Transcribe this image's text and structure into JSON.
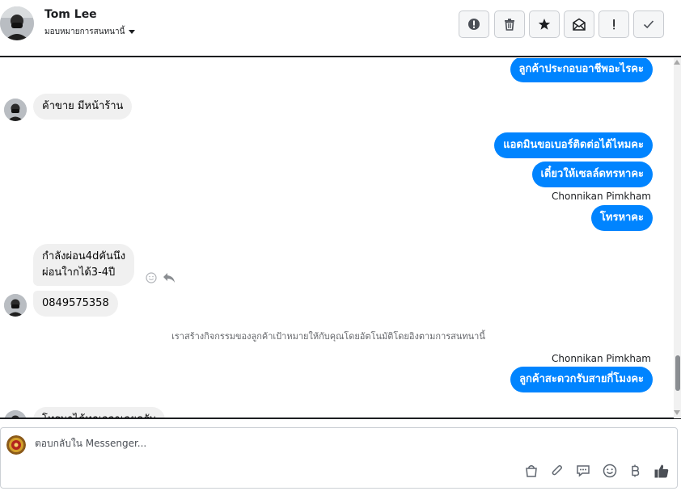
{
  "header": {
    "contact_name": "Tom Lee",
    "assign_label": "มอบหมายการสนทนานี้",
    "buttons": [
      "mark-as-spam",
      "delete",
      "star",
      "mark-unread",
      "follow-up",
      "mark-done"
    ]
  },
  "colors": {
    "outgoing_bubble": "#0084ff",
    "incoming_bubble": "#f0f0f0"
  },
  "conversation": {
    "msg1": "ลูกค้าประกอบอาชีพอะไรคะ",
    "msg2": "ค้าขาย มีหน้าร้าน",
    "msg3": "แอดมินขอเบอร์ติดต่อได้ไหมคะ",
    "msg4": "เดี๋ยวให้เซลล์ดทรหาคะ",
    "sender1": "Chonnikan Pimkham",
    "msg5": "โทรหาคะ",
    "msg6_line1": "กำลังผ่อน4dคันนึง",
    "msg6_line2": "ผ่อนใากได้3-4ปี",
    "msg7": "0849575358",
    "system_notice": "เราสร้างกิจกรรมของลูกค้าเป้าหมายให้กับคุณโดยอัตโนมัติโดยอิงตามการสนทนานี้",
    "sender2": "Chonnikan Pimkham",
    "msg8": "ลูกค้าสะดวกรับสายกี่โมงคะ",
    "msg9_partial": "โทรมาได้ทุกเวลาเลยครับ"
  },
  "composer": {
    "placeholder": "ตอบกลับใน Messenger...",
    "tools": [
      "shop-icon",
      "attachment-icon",
      "saved-reply-icon",
      "emoji-icon",
      "baht-payment-icon",
      "like-icon"
    ]
  }
}
